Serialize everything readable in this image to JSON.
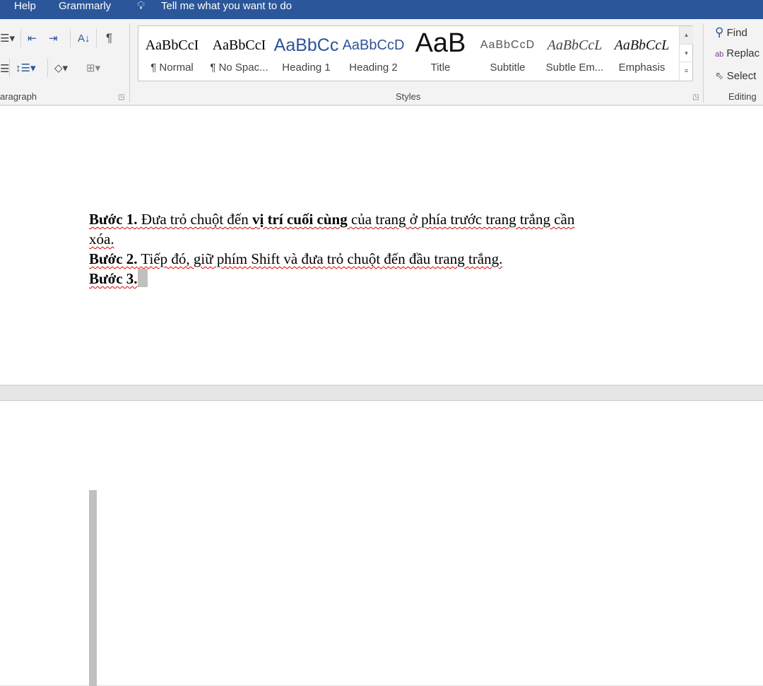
{
  "titlebar": {
    "help": "Help",
    "grammarly": "Grammarly",
    "tell_me": "Tell me what you want to do",
    "colors": {
      "bar": "#2b579a"
    }
  },
  "ribbon": {
    "paragraph_label": "aragraph",
    "styles_label": "Styles",
    "editing_label": "Editing",
    "styles": [
      {
        "preview": "AaBbCcI",
        "name": "¶ Normal"
      },
      {
        "preview": "AaBbCcI",
        "name": "¶ No Spac..."
      },
      {
        "preview": "AaBbCc",
        "name": "Heading 1"
      },
      {
        "preview": "AaBbCcD",
        "name": "Heading 2"
      },
      {
        "preview": "AaB",
        "name": "Title"
      },
      {
        "preview": "AaBbCcD",
        "name": "Subtitle"
      },
      {
        "preview": "AaBbCcL",
        "name": "Subtle Em..."
      },
      {
        "preview": "AaBbCcL",
        "name": "Emphasis"
      }
    ],
    "editing": {
      "find": "Find",
      "replace": "Replac",
      "select": "Select"
    }
  },
  "document": {
    "l1_b1": "Bước 1.",
    "l1_t1": " Đưa trỏ chuột đến ",
    "l1_b2": "vị trí cuối cùng",
    "l1_t2": " của trang ở phía trước trang trắng cần",
    "l2": "xóa.",
    "l3_b": "Bước 2.",
    "l3_t": " Tiếp đó, giữ phím Shift và đưa trỏ chuột đến đầu trang trắng.",
    "l4_b": "Bước 3."
  }
}
